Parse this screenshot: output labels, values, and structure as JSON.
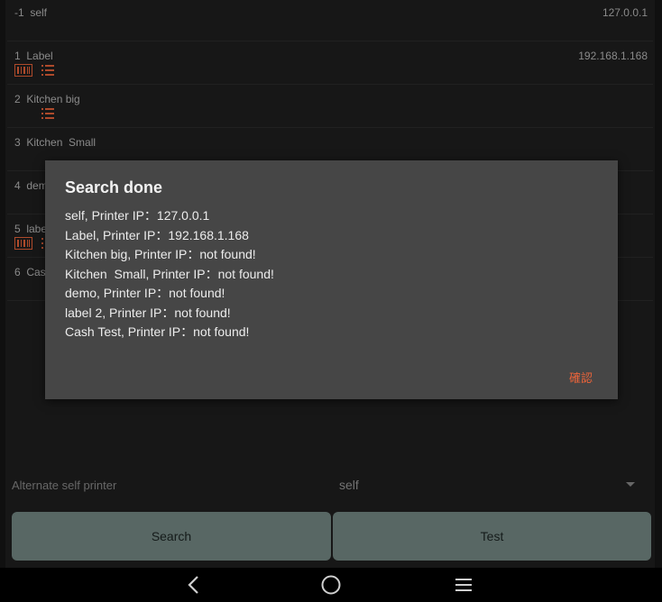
{
  "printers": [
    {
      "label": "-1  self",
      "ip": "127.0.0.1",
      "icons": []
    },
    {
      "label": "1  Label",
      "ip": "192.168.1.168",
      "icons": [
        "barcode-icon",
        "list-icon"
      ]
    },
    {
      "label": "2  Kitchen big",
      "ip": "",
      "icons": [
        "spacer",
        "list-icon"
      ]
    },
    {
      "label": "3  Kitchen  Small",
      "ip": "",
      "icons": []
    },
    {
      "label": "4  demo",
      "ip": "",
      "icons": []
    },
    {
      "label": "5  label 2",
      "ip": "",
      "icons": [
        "barcode-icon",
        "list-icon"
      ]
    },
    {
      "label": "6  Cash Test",
      "ip": "",
      "icons": []
    }
  ],
  "alternate": {
    "label": "Alternate self printer",
    "value": "self"
  },
  "buttons": {
    "search": "Search",
    "test": "Test"
  },
  "dialog": {
    "title": "Search done",
    "lines": [
      "self, Printer IP：127.0.0.1",
      "Label, Printer IP：192.168.1.168",
      "Kitchen big, Printer IP：not found!",
      "Kitchen  Small, Printer IP：not found!",
      "demo, Printer IP：not found!",
      "label 2, Printer IP：not found!",
      "Cash Test, Printer IP：not found!"
    ],
    "ok_label": "確認"
  },
  "colors": {
    "accent": "#e8633a",
    "button": "#768a86",
    "icon": "#e8633a"
  }
}
